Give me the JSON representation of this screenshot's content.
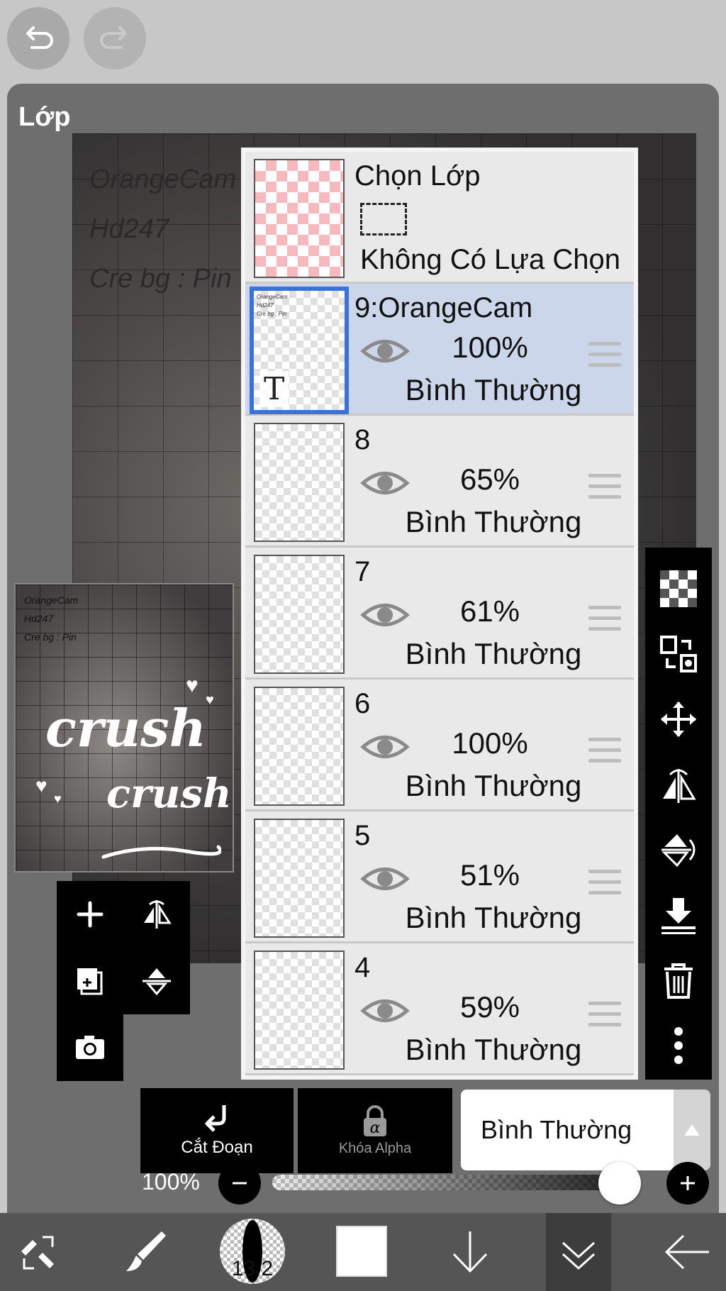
{
  "panel": {
    "title": "Lớp"
  },
  "canvas_lines": [
    "OrangeCam",
    "Hd247",
    "Cre bg : Pin"
  ],
  "thumbnail": {
    "lines": [
      "OrangeCam",
      "Hd247",
      "Cre bg : Pin"
    ],
    "text1": "crush",
    "text2": "crush"
  },
  "selection_layer": {
    "title": "Chọn Lớp",
    "status": "Không Có Lựa Chọn"
  },
  "layers": [
    {
      "name": "9:OrangeCam",
      "opacity": "100%",
      "blend": "Bình Thường",
      "selected": true,
      "thumb_lines": [
        "OrangeCam",
        "Hd247",
        "Cre bg : Pin"
      ],
      "thumb_glyph": "T"
    },
    {
      "name": "8",
      "opacity": "65%",
      "blend": "Bình Thường"
    },
    {
      "name": "7",
      "opacity": "61%",
      "blend": "Bình Thường"
    },
    {
      "name": "6",
      "opacity": "100%",
      "blend": "Bình Thường"
    },
    {
      "name": "5",
      "opacity": "51%",
      "blend": "Bình Thường"
    },
    {
      "name": "4",
      "opacity": "59%",
      "blend": "Bình Thường"
    }
  ],
  "actions": {
    "clip_label": "Cắt Đoạn",
    "alpha_lock_label": "Khóa Alpha",
    "blend_mode": "Bình Thường"
  },
  "opacity_slider": {
    "label": "100%",
    "value": 1.0
  },
  "brush": {
    "size": "13.2"
  },
  "colors": {
    "accent": "#3b72d8",
    "selected_row": "#ccd6ea",
    "panel": "#6e6e6e"
  }
}
